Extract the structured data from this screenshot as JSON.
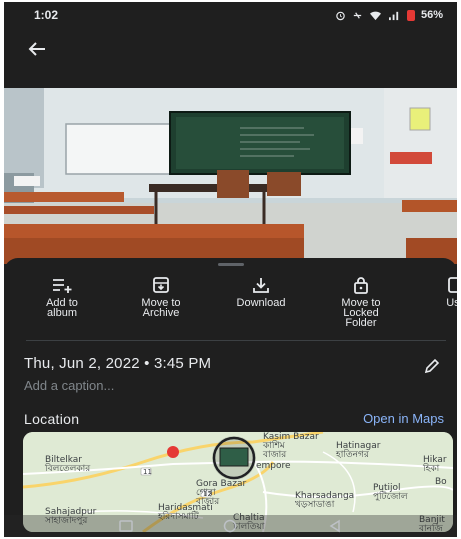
{
  "status_bar": {
    "time": "1:02",
    "battery": "56%",
    "icons": [
      "alarm-icon",
      "do-not-disturb-icon",
      "wifi-icon",
      "signal-icon",
      "battery-icon"
    ]
  },
  "top_bar": {
    "back_icon": "arrow-back-icon"
  },
  "actions": [
    {
      "label": "Add to\nalbum",
      "icon": "add-to-album-icon"
    },
    {
      "label": "Move to\nArchive",
      "icon": "archive-icon"
    },
    {
      "label": "Download",
      "icon": "download-icon"
    },
    {
      "label": "Move to\nLocked\nFolder",
      "icon": "lock-icon"
    },
    {
      "label": "Use",
      "icon": "use-as-icon"
    }
  ],
  "details": {
    "datetime": "Thu, Jun 2, 2022 • 3:45 PM",
    "caption_placeholder": "Add a caption...",
    "edit_icon": "pencil-icon"
  },
  "location": {
    "title": "Location",
    "open_link": "Open in Maps",
    "map_labels": {
      "biltelkar": "Biltelkar\nবিলতেলকার",
      "kasim_bazar": "Kasim Bazar\nকাশিম\nবাজার",
      "hatinagar": "Hatinagar\nহাতিনগর",
      "hikar": "Hikar\nহিকা",
      "empore": "empore",
      "gora_bazar": "Gora Bazar\nগোরা\nবাজার",
      "kharsadanga": "Kharsadanga\nখড়সাডাঙা",
      "putijol": "Putijol\nপুটিজোল",
      "sahajadpur": "Sahajadpur\nসাহাজাদপুর",
      "haridasmati": "Haridasmati\nহরিদাসমাটি",
      "chaltia": "Chaltia\nচালতিয়া",
      "banjit": "Banjit\nবানজি",
      "bo": "Bo",
      "road_11": "11",
      "road_12": "12"
    }
  },
  "nav_bar": [
    "recents-icon",
    "home-icon",
    "back-triangle-icon"
  ],
  "colors": {
    "background": "#1f1f1f",
    "text": "#e8eaed",
    "link": "#8ab4f8",
    "secondary_text": "#80868b"
  }
}
